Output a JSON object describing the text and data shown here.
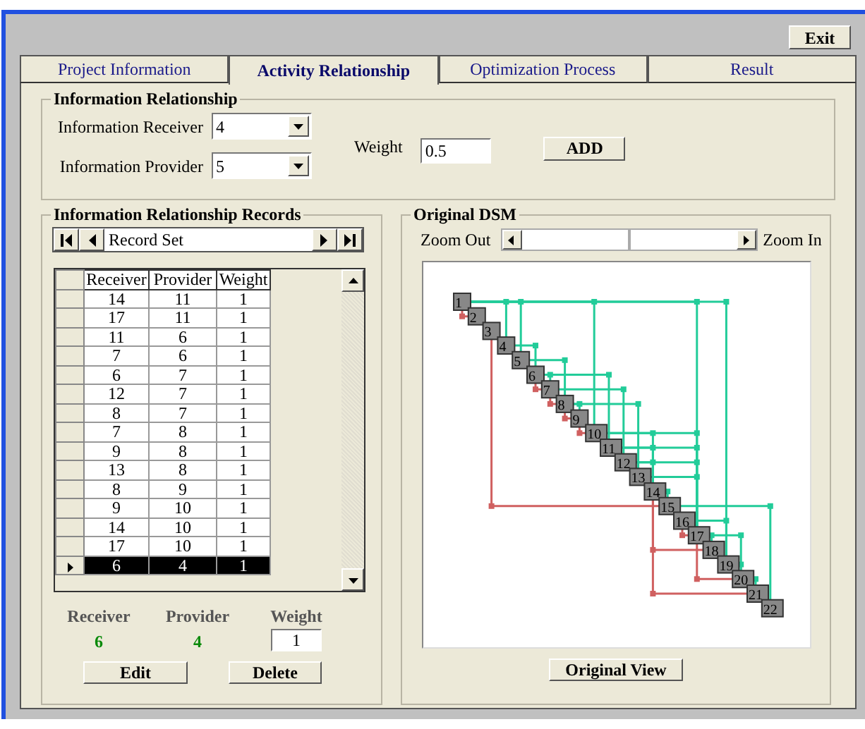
{
  "exit_button": "Exit",
  "tabs": [
    {
      "label": "Project Information",
      "selected": false
    },
    {
      "label": "Activity Relationship",
      "selected": true
    },
    {
      "label": "Optimization Process",
      "selected": false
    },
    {
      "label": "Result",
      "selected": false
    }
  ],
  "information_relationship": {
    "title": "Information Relationship",
    "receiver_label": "Information Receiver",
    "receiver_value": "4",
    "provider_label": "Information Provider",
    "provider_value": "5",
    "weight_label": "Weight",
    "weight_value": "0.5",
    "add_button": "ADD"
  },
  "records": {
    "title": "Information Relationship Records",
    "navigator_caption": "Record Set",
    "columns": [
      "Receiver",
      "Provider",
      "Weight"
    ],
    "rows": [
      {
        "cells": [
          "14",
          "11",
          "1"
        ],
        "selected": false
      },
      {
        "cells": [
          "17",
          "11",
          "1"
        ],
        "selected": false
      },
      {
        "cells": [
          "11",
          "6",
          "1"
        ],
        "selected": false
      },
      {
        "cells": [
          "7",
          "6",
          "1"
        ],
        "selected": false
      },
      {
        "cells": [
          "6",
          "7",
          "1"
        ],
        "selected": false
      },
      {
        "cells": [
          "12",
          "7",
          "1"
        ],
        "selected": false
      },
      {
        "cells": [
          "8",
          "7",
          "1"
        ],
        "selected": false
      },
      {
        "cells": [
          "7",
          "8",
          "1"
        ],
        "selected": false
      },
      {
        "cells": [
          "9",
          "8",
          "1"
        ],
        "selected": false
      },
      {
        "cells": [
          "13",
          "8",
          "1"
        ],
        "selected": false
      },
      {
        "cells": [
          "8",
          "9",
          "1"
        ],
        "selected": false
      },
      {
        "cells": [
          "9",
          "10",
          "1"
        ],
        "selected": false
      },
      {
        "cells": [
          "14",
          "10",
          "1"
        ],
        "selected": false
      },
      {
        "cells": [
          "17",
          "10",
          "1"
        ],
        "selected": false
      },
      {
        "cells": [
          "6",
          "4",
          "1"
        ],
        "selected": true
      }
    ],
    "detail": {
      "receiver_label": "Receiver",
      "receiver_value": "6",
      "provider_label": "Provider",
      "provider_value": "4",
      "weight_label": "Weight",
      "weight_value": "1"
    },
    "edit_button": "Edit",
    "delete_button": "Delete"
  },
  "dsm": {
    "title": "Original DSM",
    "zoom_out": "Zoom Out",
    "zoom_in": "Zoom In",
    "zoom": {
      "level": 0.5
    },
    "nodes": [
      "1",
      "2",
      "3",
      "4",
      "5",
      "6",
      "7",
      "8",
      "9",
      "10",
      "11",
      "12",
      "13",
      "14",
      "15",
      "16",
      "17",
      "18",
      "19",
      "20",
      "21",
      "22"
    ],
    "original_view_button": "Original View"
  }
}
